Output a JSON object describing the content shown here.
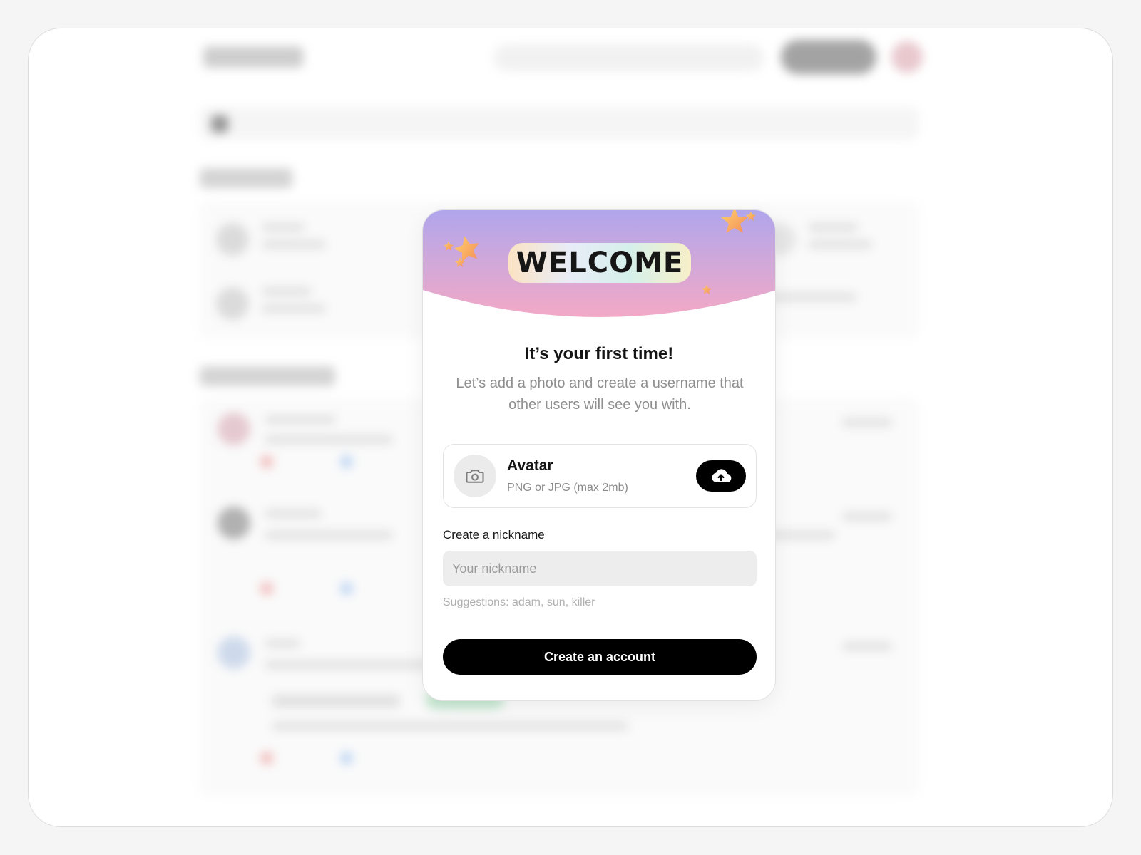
{
  "modal": {
    "banner_text": "WELCOME",
    "title": "It’s your first time!",
    "subtitle": "Let’s add a photo and create a username that other users will see you with.",
    "avatar": {
      "title": "Avatar",
      "hint": "PNG or JPG (max 2mb)",
      "placeholder_icon": "camera-icon",
      "upload_icon": "cloud-upload-icon"
    },
    "nickname": {
      "label": "Create a nickname",
      "value": "",
      "placeholder": "Your nickname",
      "suggestions_label": "Suggestions:",
      "suggestions": [
        "adam",
        "sun",
        "killer"
      ]
    },
    "submit_label": "Create an account"
  },
  "colors": {
    "banner_gradient_top": "#b0a6ec",
    "banner_gradient_bottom": "#f3a9c6",
    "primary": "#000000",
    "input_bg": "#ededed",
    "muted_text": "#8f8f8f"
  }
}
